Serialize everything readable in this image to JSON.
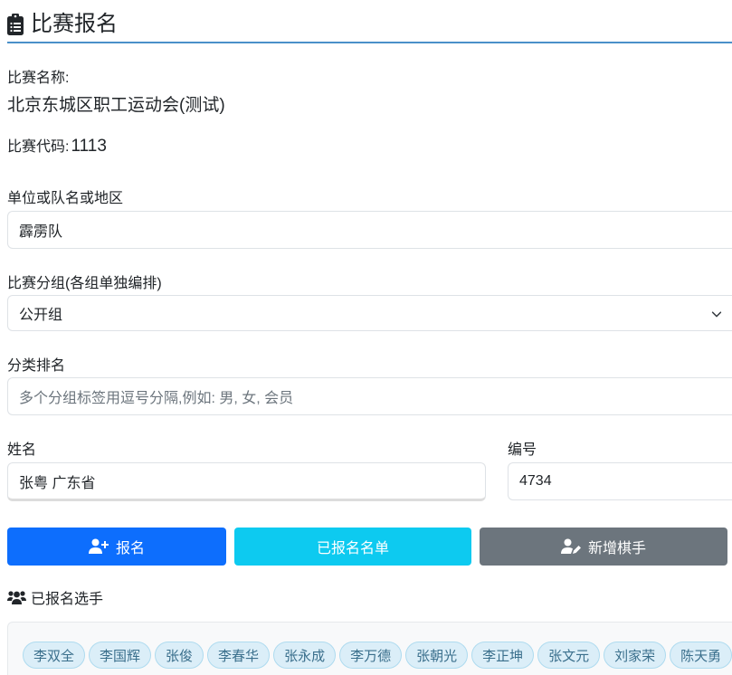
{
  "header": {
    "title": "比赛报名",
    "icon": "clipboard-icon"
  },
  "competition": {
    "name_label": "比赛名称:",
    "name_value": "北京东城区职工运动会(测试)",
    "code_label": "比赛代码:",
    "code_value": "1113"
  },
  "form": {
    "team_label": "单位或队名或地区",
    "team_value": "霹雳队",
    "group_label": "比赛分组(各组单独编排)",
    "group_selected": "公开组",
    "category_label": "分类排名",
    "category_placeholder": "多个分组标签用逗号分隔,例如: 男, 女, 会员",
    "name_label": "姓名",
    "name_value": "张粤 广东省",
    "number_label": "编号",
    "number_value": "4734"
  },
  "buttons": {
    "register": "报名",
    "registered_list": "已报名名单",
    "add_player": "新增棋手"
  },
  "section": {
    "registered_title": "已报名选手"
  },
  "players": [
    "李双全",
    "李国辉",
    "张俊",
    "李春华",
    "张永成",
    "李万德",
    "张朝光",
    "李正坤",
    "张文元",
    "刘家荣",
    "陈天勇"
  ],
  "colors": {
    "primary": "#0d6efd",
    "info": "#0dcaf0",
    "secondary": "#6c757d",
    "header_rule": "#4a90c9"
  }
}
